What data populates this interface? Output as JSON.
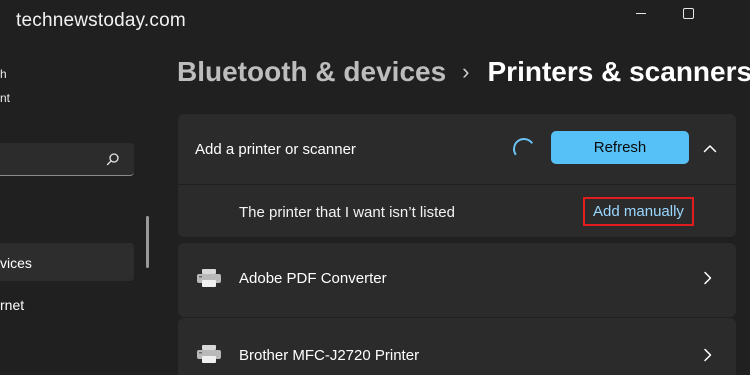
{
  "watermark": "technewstoday.com",
  "window_controls": [
    "minimize-icon",
    "maximize-icon"
  ],
  "sidebar": {
    "fragment_1": "h",
    "fragment_2": "nt",
    "search_icon": "search-icon",
    "selected_item_label": "vices",
    "item_2_label": "rnet"
  },
  "breadcrumb": {
    "parent": "Bluetooth & devices",
    "separator": "›",
    "current": "Printers & scanners"
  },
  "add_printer": {
    "label": "Add a printer or scanner",
    "refresh_label": "Refresh",
    "not_listed_label": "The printer that I want isn’t listed",
    "add_manually_label": "Add manually"
  },
  "printers": [
    {
      "name": "Adobe PDF Converter",
      "icon": "printer-icon"
    },
    {
      "name": "Brother MFC-J2720 Printer",
      "icon": "printer-icon"
    }
  ],
  "colors": {
    "background": "#202020",
    "card": "#2b2b2b",
    "accent": "#55c1f7",
    "highlight_box": "#e11d1d",
    "link": "#9ad7ff"
  }
}
